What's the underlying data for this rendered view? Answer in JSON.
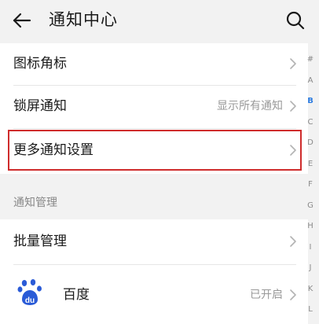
{
  "header": {
    "title": "通知中心"
  },
  "settings": {
    "badge_label": "图标角标",
    "lock_label": "锁屏通知",
    "lock_value": "显示所有通知",
    "more_label": "更多通知设置"
  },
  "section": {
    "title": "通知管理"
  },
  "manage": {
    "batch_label": "批量管理",
    "app_name": "百度",
    "app_status": "已开启",
    "app_icon": "baidu-paw-icon"
  },
  "index_letters": [
    "#",
    "A",
    "B",
    "C",
    "D",
    "E",
    "F",
    "G",
    "H",
    "I",
    "J",
    "K",
    "L"
  ],
  "active_letter": "B",
  "colors": {
    "background": "#f2f2f2",
    "card": "#ffffff",
    "highlight": "#cf2c2c",
    "index_active": "#2f7de1",
    "baidu_blue": "#2a5bd7"
  }
}
